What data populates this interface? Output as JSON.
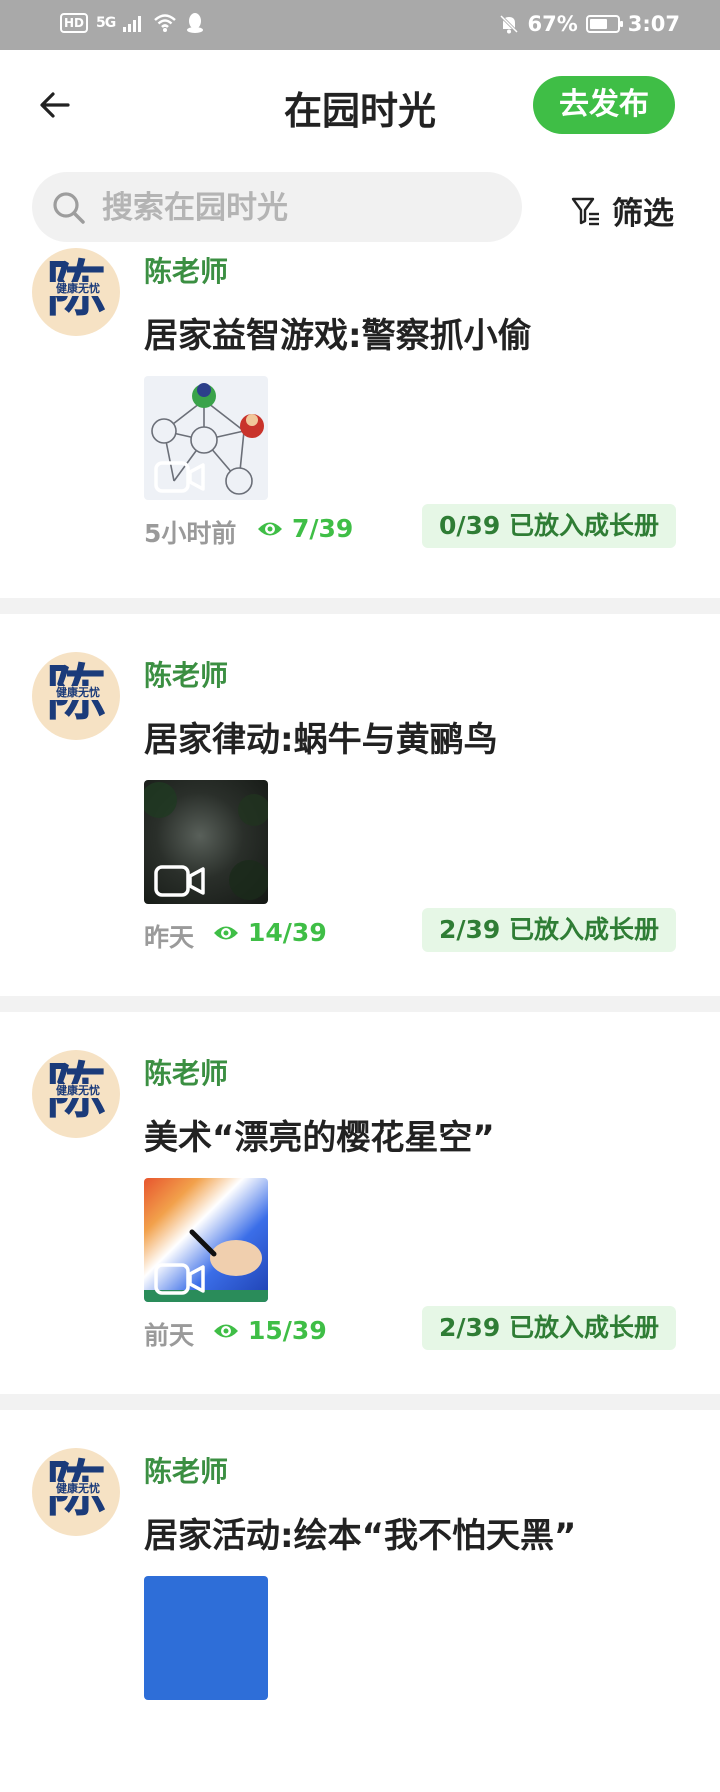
{
  "status_bar": {
    "hd": "HD",
    "network": "5G",
    "battery_percent": "67%",
    "battery_level": 0.67,
    "time": "3:07"
  },
  "header": {
    "title": "在园时光",
    "publish_label": "去发布"
  },
  "search": {
    "placeholder": "搜索在园时光",
    "value": ""
  },
  "filter": {
    "label": "筛选"
  },
  "posts": [
    {
      "avatar_char": "陈",
      "avatar_caption": "健康无忧",
      "author": "陈老师",
      "title": "居家益智游戏:警察抓小偷",
      "time": "5小时前",
      "views": "7/39",
      "growth": "0/39 已放入成长册"
    },
    {
      "avatar_char": "陈",
      "avatar_caption": "健康无忧",
      "author": "陈老师",
      "title": "居家律动:蜗牛与黄鹂鸟",
      "time": "昨天",
      "views": "14/39",
      "growth": "2/39 已放入成长册"
    },
    {
      "avatar_char": "陈",
      "avatar_caption": "健康无忧",
      "author": "陈老师",
      "title": "美术“漂亮的樱花星空”",
      "time": "前天",
      "views": "15/39",
      "growth": "2/39 已放入成长册"
    },
    {
      "avatar_char": "陈",
      "avatar_caption": "健康无忧",
      "author": "陈老师",
      "title": "居家活动:绘本“我不怕天黑”"
    }
  ],
  "colors": {
    "accent_green": "#3fbe46",
    "author_green": "#3b8f42",
    "badge_bg": "#e6f7e6",
    "avatar_navy": "#1b3b7a"
  }
}
